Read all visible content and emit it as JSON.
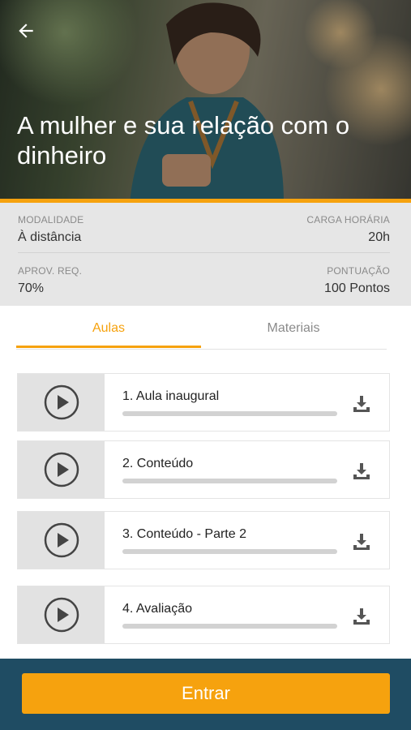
{
  "hero": {
    "title": "A mulher e sua relação com o dinheiro",
    "back_icon": "arrow-left-icon",
    "accent_color": "#f6a20e"
  },
  "info": {
    "modalidade_label": "MODALIDADE",
    "modalidade_value": "À distância",
    "carga_label": "CARGA HORÁRIA",
    "carga_value": "20h",
    "aprov_label": "APROV. REQ.",
    "aprov_value": "70%",
    "pontuacao_label": "PONTUAÇÃO",
    "pontuacao_value": "100 Pontos"
  },
  "tabs": [
    {
      "label": "Aulas",
      "active": true
    },
    {
      "label": "Materiais",
      "active": false
    }
  ],
  "lessons": [
    {
      "title": "1. Aula inaugural",
      "progress": 0,
      "icon": "play-circle-icon",
      "action_icon": "download-icon"
    },
    {
      "title": "2. Conteúdo",
      "progress": 0,
      "icon": "play-circle-icon",
      "action_icon": "download-icon"
    },
    {
      "title": "3. Conteúdo - Parte 2",
      "progress": 0,
      "icon": "play-circle-icon",
      "action_icon": "download-icon"
    },
    {
      "title": "4. Avaliação",
      "progress": 0,
      "icon": "play-circle-icon",
      "action_icon": "download-icon"
    }
  ],
  "footer": {
    "enter_label": "Entrar",
    "background_color": "#1f4c63",
    "button_color": "#f6a20e"
  }
}
